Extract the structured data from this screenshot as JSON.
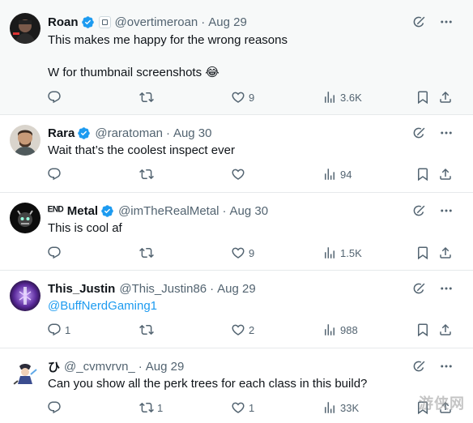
{
  "colors": {
    "accent": "#1d9bf0",
    "text": "#0f1419",
    "muted": "#536471",
    "divider": "#e6e9eb"
  },
  "tweets": [
    {
      "name": "Roan",
      "verified": true,
      "affiliation_badge": true,
      "handle": "@overtimeroan",
      "sep": "·",
      "time": "Aug 29",
      "lines": [
        "This makes me happy for the wrong reasons",
        "",
        "W for thumbnail screenshots 😂"
      ],
      "replies": "",
      "likes": "9",
      "views": "3.6K"
    },
    {
      "name": "Rara",
      "verified": true,
      "handle": "@raratoman",
      "sep": "·",
      "time": "Aug 30",
      "lines": [
        "Wait that’s the coolest inspect ever"
      ],
      "replies": "",
      "likes": "",
      "views": "94"
    },
    {
      "name": "ᴱᴺᴰ Metal",
      "verified": true,
      "handle": "@imTheRealMetal",
      "sep": "·",
      "time": "Aug 30",
      "lines": [
        "This is cool af"
      ],
      "replies": "",
      "likes": "9",
      "views": "1.5K"
    },
    {
      "name": "This_Justin",
      "verified": false,
      "handle": "@This_Justin86",
      "sep": "·",
      "time": "Aug 29",
      "mention": "@BuffNerdGaming1",
      "replies": "1",
      "likes": "2",
      "views": "988"
    },
    {
      "name": "ひ",
      "verified": false,
      "handle": "@_cvmvrvn_",
      "sep": "·",
      "time": "Aug 29",
      "lines": [
        "Can you show all the perk trees for each class in this build?"
      ],
      "replies": "",
      "retweets": "1",
      "likes": "1",
      "views": "33K"
    }
  ],
  "icons": {
    "reply": "reply-icon",
    "retweet": "retweet-icon",
    "like": "heart-icon",
    "views": "views-icon",
    "bookmark": "bookmark-icon",
    "share": "share-icon",
    "grok": "grok-icon",
    "more": "more-icon",
    "verified": "verified-badge-icon"
  },
  "watermark": "游侠网"
}
